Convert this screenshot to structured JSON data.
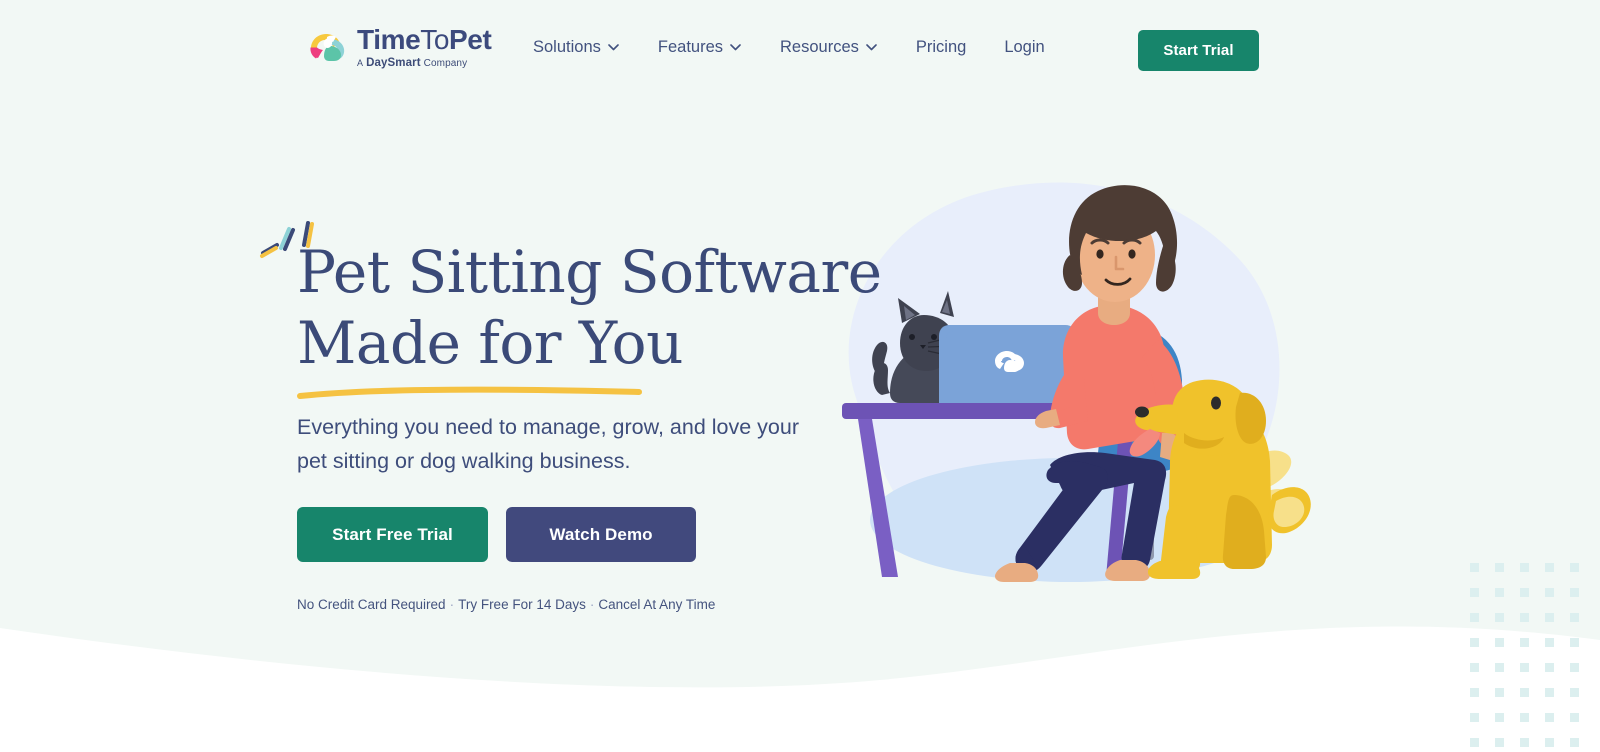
{
  "theme": {
    "bg_mint": "#f2f8f5",
    "bg_white": "#ffffff",
    "navy": "#3b4a78",
    "green": "#17856b",
    "indigo": "#41497d",
    "yellow": "#f5c242",
    "teal_dot": "#dcefef"
  },
  "header": {
    "logo": {
      "icon": "timetopet-paw-logo-icon",
      "wordmark_bold": "Time",
      "wordmark_light": "To",
      "wordmark_bold2": "Pet",
      "tagline_a": "A",
      "tagline_brand": "DaySmart",
      "tagline_company": "Company"
    },
    "nav": [
      {
        "label": "Solutions",
        "has_dropdown": true
      },
      {
        "label": "Features",
        "has_dropdown": true
      },
      {
        "label": "Resources",
        "has_dropdown": true
      },
      {
        "label": "Pricing",
        "has_dropdown": false
      },
      {
        "label": "Login",
        "has_dropdown": false
      }
    ],
    "cta_label": "Start Trial"
  },
  "hero": {
    "headline_line1": "Pet Sitting Software",
    "headline_line2": "Made for You",
    "subheadline": "Everything you need to manage, grow, and love your pet sitting or dog walking business.",
    "primary_cta": "Start Free Trial",
    "secondary_cta": "Watch Demo",
    "fineprint": [
      "No Credit Card Required",
      "Try Free For 14 Days",
      "Cancel At Any Time"
    ],
    "fineprint_separator": "·",
    "illustration_alt": "woman-at-desk-with-laptop-cat-and-dog-illustration"
  }
}
